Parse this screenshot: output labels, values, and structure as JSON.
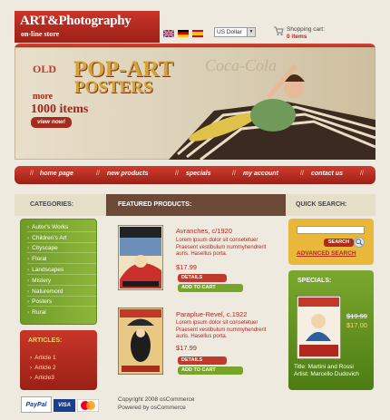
{
  "store": {
    "title": "ART&Photography",
    "subtitle": "on-line store"
  },
  "currency": {
    "selected": "US Dollar"
  },
  "cart": {
    "label": "Shopping cart:",
    "count": "0 items"
  },
  "banner": {
    "old": "OLD",
    "pop": "POP-ART",
    "posters": "POSTERS",
    "more": "more",
    "items": "1000 items",
    "view": "view now!",
    "brand": "Coca-Cola"
  },
  "nav": [
    "home page",
    "new products",
    "specials",
    "my account",
    "contact us"
  ],
  "headers": {
    "categories": "CATEGORIES:",
    "featured": "FEATURED PRODUCTS:",
    "quick": "QUICK SEARCH:"
  },
  "categories": [
    "Autor's Works",
    "Children's Art",
    "Cityscape",
    "Floral",
    "Landscapes",
    "Mistery",
    "Naturemord",
    "Posters",
    "Rural"
  ],
  "articles": {
    "title": "ARTICLES:",
    "items": [
      "Article 1",
      "Article 2",
      "Article3"
    ]
  },
  "products": [
    {
      "title": "Avranches, c/1920",
      "desc": "Lorem ipsum dolor sit consetetuer Praesent vestibulum nummyhendrerit auris. Hasellus porta.",
      "price": "$17.99",
      "details": "DETAILS",
      "add": "ADD TO CART"
    },
    {
      "title": "Paraplue-Revel, c.1922",
      "desc": "Lorem ipsum dolor sit consetetuer Praesent vestibulum nummyhendrerit auris. Hasellus porta.",
      "price": "$17.99",
      "details": "DETAILS",
      "add": "ADD TO CART"
    }
  ],
  "search": {
    "button": "SEARCH",
    "advanced": "ADVANCED SEARCH"
  },
  "specials": {
    "title": "SPECIALS:",
    "old_price": "$19.99",
    "new_price": "$17.00",
    "item_title": "Title: Martini and Rossi",
    "item_artist": "Artist: Marcello Dudovich"
  },
  "footer": {
    "copy": "Copyright 2008 osCommerce",
    "powered": "Powered by osCommerce",
    "paypal": "PayPal",
    "visa": "VISA"
  },
  "colors": {
    "red": "#b0281e",
    "green": "#76a52a",
    "gold": "#e9b83a",
    "brown": "#6d4a37"
  }
}
